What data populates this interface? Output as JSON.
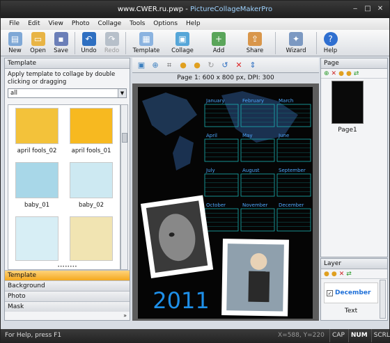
{
  "window": {
    "site": "www.CWER.ru.pwp - ",
    "app": "PictureCollageMakerPro"
  },
  "menu": [
    "File",
    "Edit",
    "View",
    "Photo",
    "Collage",
    "Tools",
    "Options",
    "Help"
  ],
  "toolbar": [
    {
      "label": "New",
      "icon": "new-file-icon",
      "color": "#7fa8d6"
    },
    {
      "label": "Open",
      "icon": "folder-open-icon",
      "color": "#e8b445"
    },
    {
      "label": "Save",
      "icon": "save-disk-icon",
      "color": "#6b7fb8"
    },
    {
      "label": "Undo",
      "icon": "undo-arrow-icon",
      "color": "#2e6fc1"
    },
    {
      "label": "Redo",
      "icon": "redo-arrow-icon",
      "color": "#b7c0ca",
      "disabled": true
    },
    {
      "label": "Template",
      "icon": "template-icon",
      "color": "#8bb3e0"
    },
    {
      "label": "Collage",
      "icon": "collage-icon",
      "color": "#56a6d8"
    },
    {
      "label": "Add",
      "icon": "add-image-icon",
      "color": "#5aa55a"
    },
    {
      "label": "Share",
      "icon": "share-icon",
      "color": "#d9964a"
    },
    {
      "label": "Wizard",
      "icon": "wizard-icon",
      "color": "#7c99c2"
    },
    {
      "label": "Help",
      "icon": "help-icon",
      "color": "#2f6fd0"
    }
  ],
  "left_panel": {
    "title": "Template",
    "hint": "Apply template to collage by double clicking or dragging",
    "filter": "all",
    "templates": [
      {
        "name": "april fools_02",
        "color": "#f3c23a"
      },
      {
        "name": "april fools_01",
        "color": "#f7b920"
      },
      {
        "name": "baby_01",
        "color": "#a8d7e8"
      },
      {
        "name": "baby_02",
        "color": "#cde9f2"
      },
      {
        "name": "",
        "color": "#d7eef5"
      },
      {
        "name": "",
        "color": "#f1e4b2"
      }
    ],
    "tabs": [
      "Template",
      "Background",
      "Photo",
      "Mask"
    ],
    "more": "»"
  },
  "canvas": {
    "info": "Page 1: 600 x 800 px, DPI: 300",
    "year": "2011",
    "months": [
      "January",
      "February",
      "March",
      "April",
      "May",
      "June",
      "July",
      "August",
      "September",
      "October",
      "November",
      "December"
    ]
  },
  "page_panel": {
    "title": "Page",
    "page_label": "Page1"
  },
  "layer_panel": {
    "title": "Layer",
    "item_label": "December",
    "text_label": "Text"
  },
  "status": {
    "help": "For Help, press F1",
    "coords": "X=588, Y=220",
    "indicators": [
      {
        "label": "CAP",
        "on": false
      },
      {
        "label": "NUM",
        "on": true
      },
      {
        "label": "SCRL",
        "on": false
      }
    ]
  }
}
